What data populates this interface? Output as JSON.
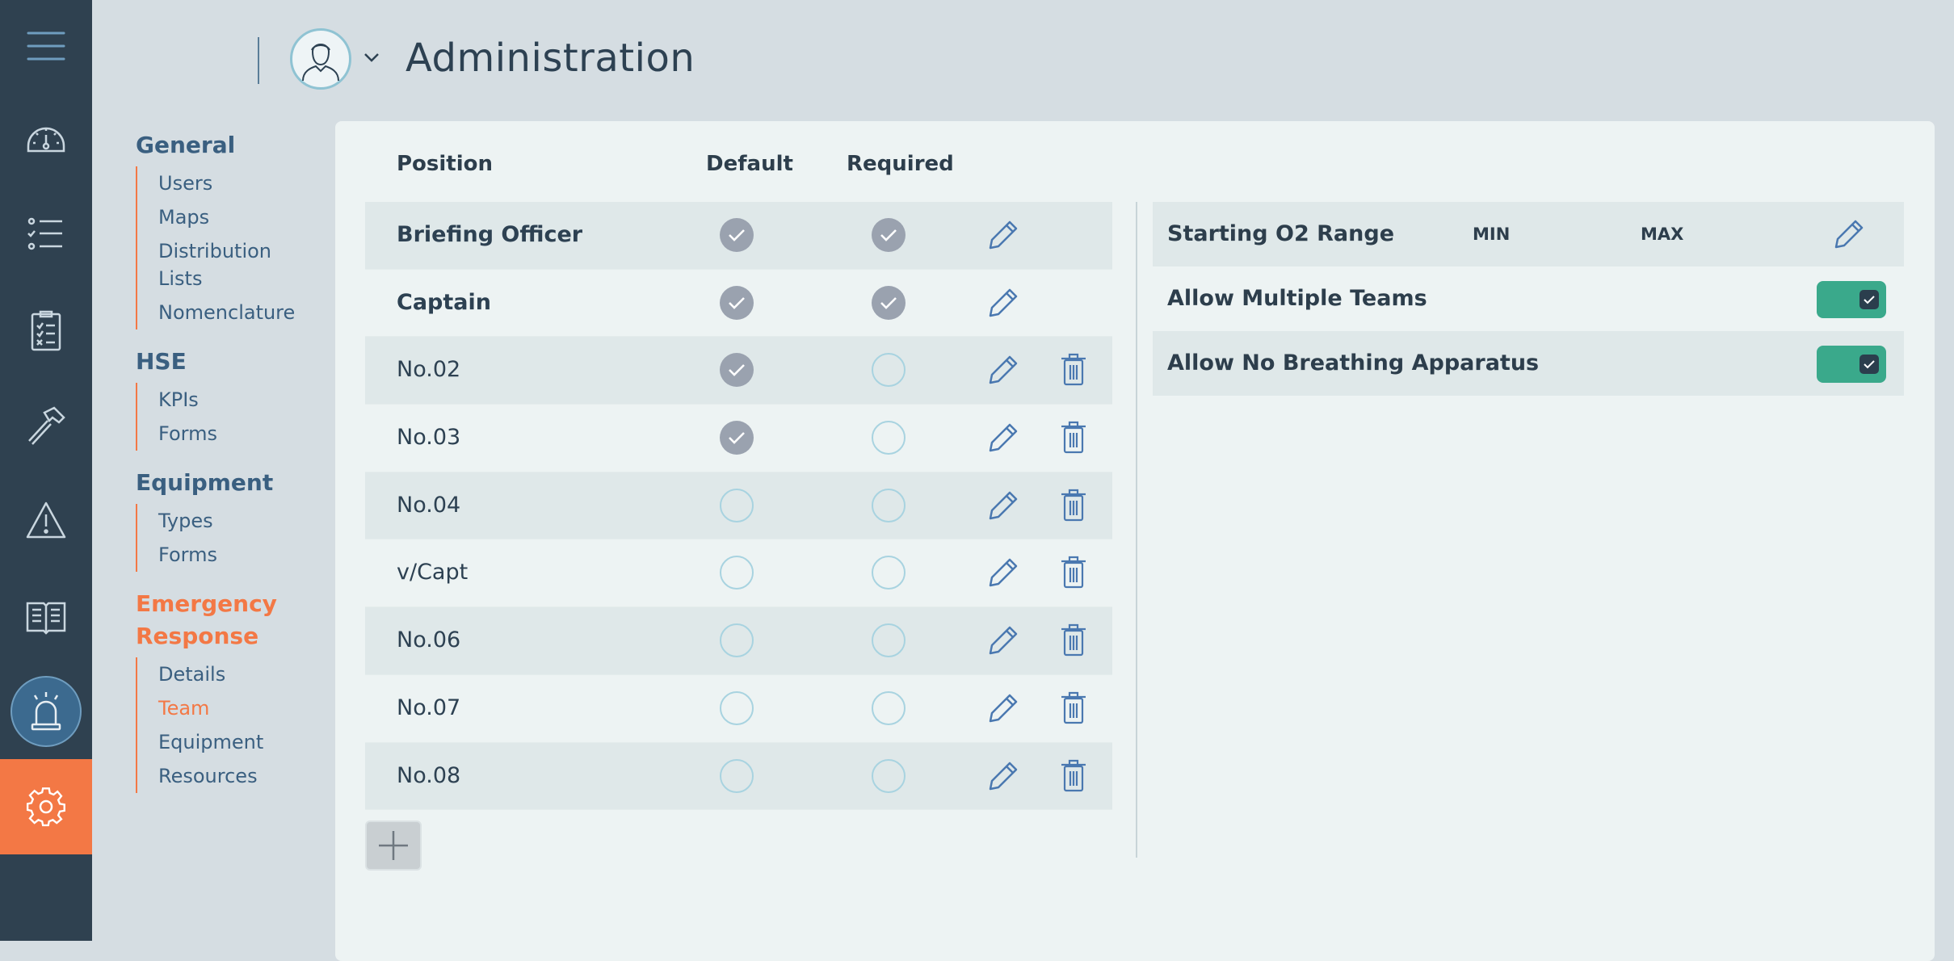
{
  "header": {
    "title": "Administration",
    "avatar_icon": "user-avatar-icon",
    "menu_icon": "hamburger-icon"
  },
  "rail": {
    "items": [
      {
        "name": "menu",
        "icon": "hamburger-icon"
      },
      {
        "name": "dashboard",
        "icon": "gauge-icon"
      },
      {
        "name": "checklists",
        "icon": "list-icon"
      },
      {
        "name": "tasks",
        "icon": "clipboard-icon"
      },
      {
        "name": "tools",
        "icon": "hammer-icon"
      },
      {
        "name": "alerts",
        "icon": "warning-icon"
      },
      {
        "name": "manuals",
        "icon": "book-icon"
      },
      {
        "name": "emergency",
        "icon": "siren-icon"
      },
      {
        "name": "settings",
        "icon": "gear-icon"
      }
    ],
    "active": "emergency",
    "accent": "#f37845"
  },
  "nav": {
    "groups": [
      {
        "heading": "General",
        "items": [
          "Users",
          "Maps",
          "Distribution Lists",
          "Nomenclature"
        ]
      },
      {
        "heading": "HSE",
        "items": [
          "KPIs",
          "Forms"
        ]
      },
      {
        "heading": "Equipment",
        "items": [
          "Types",
          "Forms"
        ]
      },
      {
        "heading": "Emergency Response",
        "items": [
          "Details",
          "Team",
          "Equipment",
          "Resources"
        ]
      }
    ],
    "active_group": "Emergency Response",
    "active_item": "Team"
  },
  "positions": {
    "columns": {
      "position": "Position",
      "default": "Default",
      "required": "Required"
    },
    "rows": [
      {
        "name": "Briefing Officer",
        "bold": true,
        "default": true,
        "required": true,
        "deletable": false
      },
      {
        "name": "Captain",
        "bold": true,
        "default": true,
        "required": true,
        "deletable": false
      },
      {
        "name": "No.02",
        "bold": false,
        "default": true,
        "required": false,
        "deletable": true
      },
      {
        "name": "No.03",
        "bold": false,
        "default": true,
        "required": false,
        "deletable": true
      },
      {
        "name": "No.04",
        "bold": false,
        "default": false,
        "required": false,
        "deletable": true
      },
      {
        "name": "v/Capt",
        "bold": false,
        "default": false,
        "required": false,
        "deletable": true
      },
      {
        "name": "No.06",
        "bold": false,
        "default": false,
        "required": false,
        "deletable": true
      },
      {
        "name": "No.07",
        "bold": false,
        "default": false,
        "required": false,
        "deletable": true
      },
      {
        "name": "No.08",
        "bold": false,
        "default": false,
        "required": false,
        "deletable": true
      }
    ],
    "add_icon": "plus-icon"
  },
  "settings": {
    "o2_range": {
      "label": "Starting O2 Range",
      "min_label": "MIN",
      "max_label": "MAX"
    },
    "allow_multiple_teams": {
      "label": "Allow Multiple Teams",
      "enabled": true
    },
    "allow_no_ba": {
      "label": "Allow No Breathing Apparatus",
      "enabled": true
    },
    "toggle_color": "#3aa98b"
  }
}
